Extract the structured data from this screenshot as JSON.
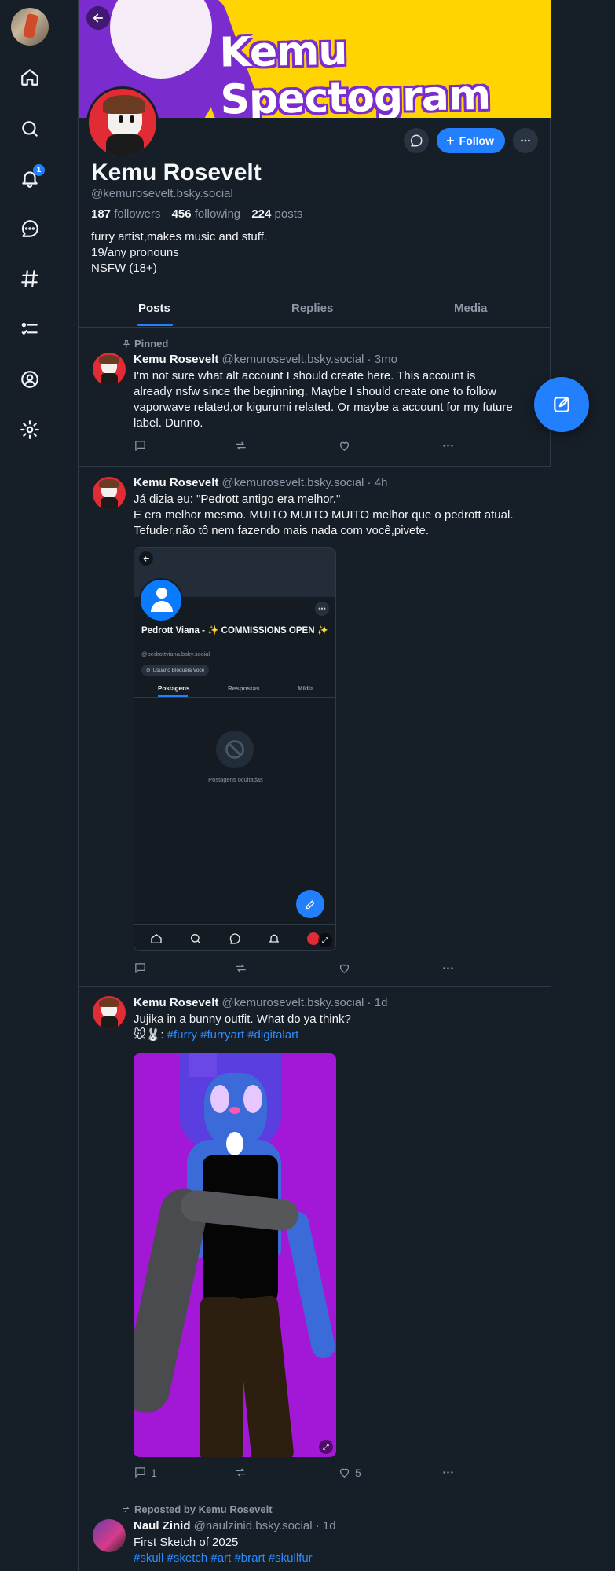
{
  "sidebar": {
    "notifications_badge": "1",
    "icons": [
      "home-icon",
      "search-icon",
      "bell-icon",
      "chat-icon",
      "hashtag-icon",
      "list-icon",
      "profile-icon",
      "gear-icon"
    ]
  },
  "banner": {
    "title": "Kemu Spectogram"
  },
  "profile": {
    "name": "Kemu Rosevelt",
    "handle": "@kemurosevelt.bsky.social",
    "followers_count": "187",
    "followers_label": "followers",
    "following_count": "456",
    "following_label": "following",
    "posts_count": "224",
    "posts_label": "posts",
    "bio": [
      "furry artist,makes music and stuff.",
      "19/any pronouns",
      "NSFW (18+)"
    ],
    "follow_label": "Follow"
  },
  "tabs": [
    {
      "label": "Posts",
      "active": true
    },
    {
      "label": "Replies",
      "active": false
    },
    {
      "label": "Media",
      "active": false
    }
  ],
  "posts": [
    {
      "context": "Pinned",
      "author": "Kemu Rosevelt",
      "handle": "@kemurosevelt.bsky.social",
      "time": "3mo",
      "lines": [
        "I'm not sure what alt account I should create here. This account is",
        "already nsfw since the beginning. Maybe I should create one to follow",
        "vaporwave related,or kigurumi related. Or maybe a account for my future",
        "label. Dunno."
      ],
      "replies": "",
      "likes": ""
    },
    {
      "author": "Kemu Rosevelt",
      "handle": "@kemurosevelt.bsky.social",
      "time": "4h",
      "lines": [
        "Já dizia eu: \"Pedrott antigo era melhor.\"",
        "E era melhor mesmo. MUITO MUITO MUITO melhor que o pedrott atual.",
        "Tefuder,não tô nem fazendo mais nada com você,pivete."
      ],
      "embed": {
        "name": "Pedrott Viana - ✨ COMMISSIONS OPEN ✨",
        "handle": "@pedrottviana.bsky.social",
        "blocked_label": "Usuário Bloqueia Você",
        "tabs": [
          "Postagens",
          "Respostas",
          "Mídia"
        ],
        "hidden_label": "Postagens ocultadas"
      },
      "replies": "",
      "likes": ""
    },
    {
      "author": "Kemu Rosevelt",
      "handle": "@kemurosevelt.bsky.social",
      "time": "1d",
      "line1": "Jujika in a bunny outfit. What do ya think?",
      "emoji_prefix": "🐭🐰: ",
      "tags": [
        "#furry",
        "#furryart",
        "#digitalart"
      ],
      "replies": "1",
      "likes": "5"
    },
    {
      "context": "Reposted by Kemu Rosevelt",
      "author": "Naul Zinid",
      "handle": "@naulzinid.bsky.social",
      "time": "1d",
      "line1": "First Sketch of 2025",
      "tags": [
        "#skull",
        "#sketch",
        "#art",
        "#brart",
        "#skullfur"
      ]
    }
  ]
}
